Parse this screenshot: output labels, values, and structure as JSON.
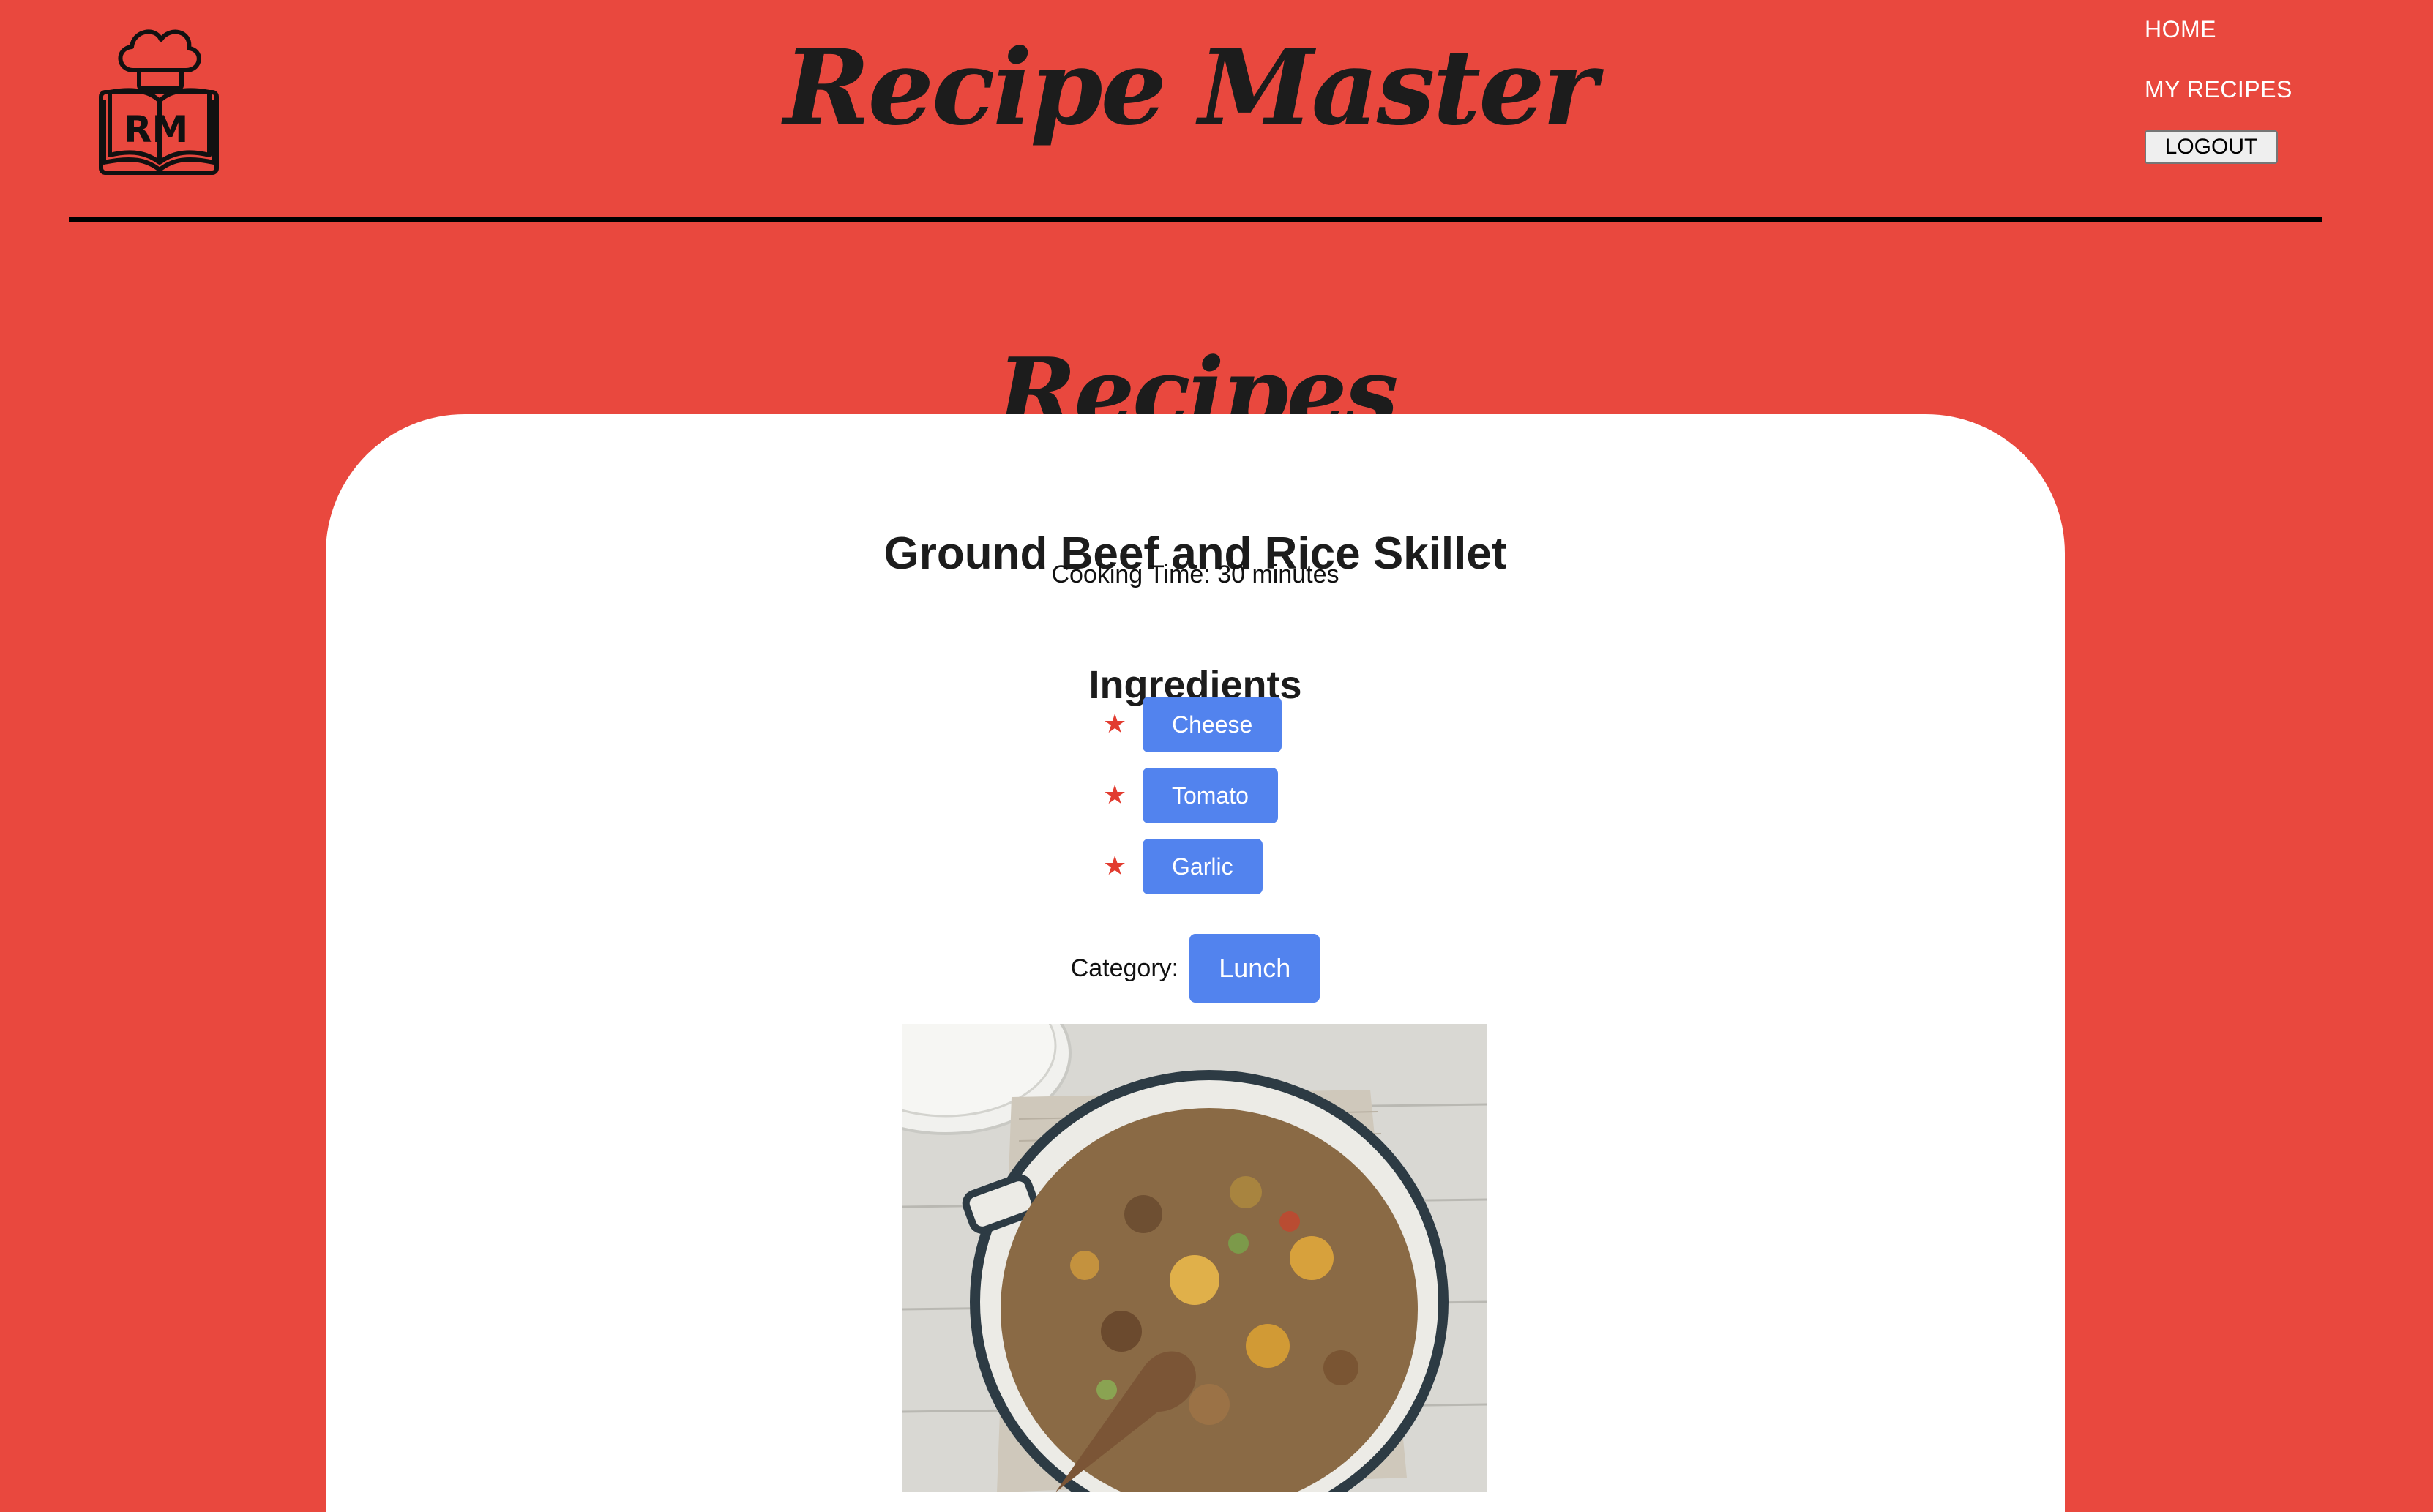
{
  "header": {
    "logo_letters": "RM",
    "site_title": "Recipe Master",
    "nav": {
      "home": "HOME",
      "my_recipes": "MY RECIPES",
      "logout": "LOGOUT"
    }
  },
  "page": {
    "title": "Recipes"
  },
  "recipe": {
    "title": "Ground Beef and Rice Skillet",
    "cooking_time": "Cooking Time: 30 minutes",
    "ingredients_heading": "Ingredients",
    "ingredients": [
      {
        "name": "Cheese",
        "icon": "star-icon"
      },
      {
        "name": "Tomato",
        "icon": "star-icon"
      },
      {
        "name": "Garlic",
        "icon": "star-icon"
      }
    ],
    "category_label": "Category:",
    "category": "Lunch"
  },
  "colors": {
    "background": "#e9483e",
    "chip": "#5283ee",
    "star": "#e23c30",
    "card": "#ffffff"
  }
}
